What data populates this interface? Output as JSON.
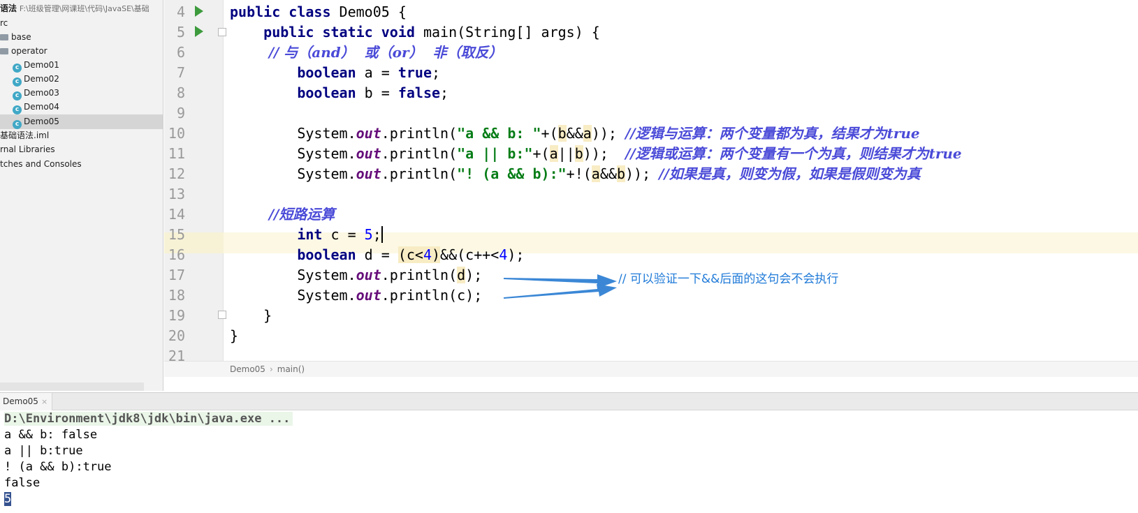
{
  "sidebar": {
    "project": {
      "name": "语法",
      "path": "F:\\班级管理\\网课班\\代码\\JavaSE\\基础"
    },
    "src": "rc",
    "folders": [
      "base",
      "operator"
    ],
    "files": [
      "Demo01",
      "Demo02",
      "Demo03",
      "Demo04",
      "Demo05"
    ],
    "selected": "Demo05",
    "iml": "基础语法.iml",
    "external": "rnal Libraries",
    "scratches": "tches and Consoles",
    "class_icon_letter": "c"
  },
  "editor": {
    "line_numbers": [
      "4",
      "5",
      "6",
      "7",
      "8",
      "9",
      "10",
      "11",
      "12",
      "13",
      "14",
      "15",
      "16",
      "17",
      "18",
      "19",
      "20",
      "21"
    ],
    "lines": [
      [
        {
          "t": "public class ",
          "c": "kw"
        },
        {
          "t": "Demo05 {",
          "c": ""
        }
      ],
      [
        {
          "t": "    public static void ",
          "c": "kw"
        },
        {
          "t": "main(String[] args) {",
          "c": ""
        }
      ],
      [
        {
          "t": "        // 与（and）  或（or）  非（取反）",
          "c": "cmt"
        }
      ],
      [
        {
          "t": "        boolean ",
          "c": "kw"
        },
        {
          "t": "a = ",
          "c": ""
        },
        {
          "t": "true",
          "c": "kw"
        },
        {
          "t": ";",
          "c": ""
        }
      ],
      [
        {
          "t": "        boolean ",
          "c": "kw"
        },
        {
          "t": "b = ",
          "c": ""
        },
        {
          "t": "false",
          "c": "kw"
        },
        {
          "t": ";",
          "c": ""
        }
      ],
      [
        {
          "t": "",
          "c": ""
        }
      ],
      [
        {
          "t": "        System.",
          "c": ""
        },
        {
          "t": "out",
          "c": "fld"
        },
        {
          "t": ".println(",
          "c": ""
        },
        {
          "t": "\"a && b: \"",
          "c": "str"
        },
        {
          "t": "+(",
          "c": ""
        },
        {
          "t": "b",
          "c": "hl"
        },
        {
          "t": "&&",
          "c": ""
        },
        {
          "t": "a",
          "c": "hl"
        },
        {
          "t": ")); ",
          "c": ""
        },
        {
          "t": "//逻辑与运算：两个变量都为真，结果才为true",
          "c": "cmt"
        }
      ],
      [
        {
          "t": "        System.",
          "c": ""
        },
        {
          "t": "out",
          "c": "fld"
        },
        {
          "t": ".println(",
          "c": ""
        },
        {
          "t": "\"a || b:\"",
          "c": "str"
        },
        {
          "t": "+(",
          "c": ""
        },
        {
          "t": "a",
          "c": "hl"
        },
        {
          "t": "||",
          "c": ""
        },
        {
          "t": "b",
          "c": "hl"
        },
        {
          "t": "));  ",
          "c": ""
        },
        {
          "t": "//逻辑或运算：两个变量有一个为真，则结果才为true",
          "c": "cmt"
        }
      ],
      [
        {
          "t": "        System.",
          "c": ""
        },
        {
          "t": "out",
          "c": "fld"
        },
        {
          "t": ".println(",
          "c": ""
        },
        {
          "t": "\"! (a && b):\"",
          "c": "str"
        },
        {
          "t": "+!(",
          "c": ""
        },
        {
          "t": "a",
          "c": "hl"
        },
        {
          "t": "&&",
          "c": ""
        },
        {
          "t": "b",
          "c": "hl"
        },
        {
          "t": ")); ",
          "c": ""
        },
        {
          "t": "//如果是真，则变为假，如果是假则变为真",
          "c": "cmt"
        }
      ],
      [
        {
          "t": "",
          "c": ""
        }
      ],
      [
        {
          "t": "        //短路运算",
          "c": "cmt"
        }
      ],
      [
        {
          "t": "        int ",
          "c": "kw"
        },
        {
          "t": "c = ",
          "c": ""
        },
        {
          "t": "5",
          "c": "num"
        },
        {
          "t": ";",
          "c": ""
        },
        {
          "t": "",
          "c": "caret"
        }
      ],
      [
        {
          "t": "        boolean ",
          "c": "kw"
        },
        {
          "t": "d = ",
          "c": ""
        },
        {
          "t": "(c<",
          "c": "hl"
        },
        {
          "t": "4",
          "c": "num hl"
        },
        {
          "t": ")",
          "c": "hl"
        },
        {
          "t": "&&(c++<",
          "c": ""
        },
        {
          "t": "4",
          "c": "num"
        },
        {
          "t": ");",
          "c": ""
        }
      ],
      [
        {
          "t": "        System.",
          "c": ""
        },
        {
          "t": "out",
          "c": "fld"
        },
        {
          "t": ".println(",
          "c": ""
        },
        {
          "t": "d",
          "c": "hl"
        },
        {
          "t": ");",
          "c": ""
        }
      ],
      [
        {
          "t": "        System.",
          "c": ""
        },
        {
          "t": "out",
          "c": "fld"
        },
        {
          "t": ".println(c);",
          "c": ""
        }
      ],
      [
        {
          "t": "    }",
          "c": ""
        }
      ],
      [
        {
          "t": "}",
          "c": ""
        }
      ],
      [
        {
          "t": "",
          "c": ""
        }
      ]
    ],
    "annotation": "// 可以验证一下&&后面的这句会不会执行"
  },
  "breadcrumb": [
    "Demo05",
    "main()"
  ],
  "run": {
    "tab": "Demo05",
    "close_symbol": "×",
    "output": [
      "D:\\Environment\\jdk8\\jdk\\bin\\java.exe ...",
      "a && b: false",
      "a || b:true",
      "! (a && b):true",
      "false",
      "5"
    ]
  },
  "colors": {
    "keyword": "#000080",
    "string": "#067d17",
    "comment": "#4a4ad8",
    "annotation": "#1f7ad8"
  }
}
